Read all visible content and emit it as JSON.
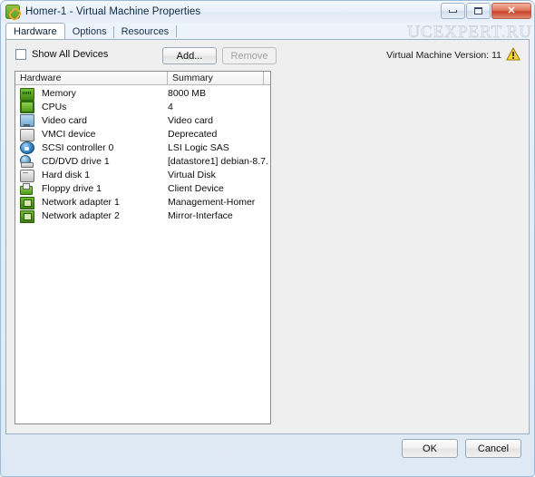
{
  "window": {
    "title": "Homer-1 - Virtual Machine Properties",
    "app_icon": "vm-properties-icon",
    "controls": {
      "minimize": "minimize-button",
      "maximize": "maximize-button",
      "close_glyph": "✕"
    }
  },
  "tabs": [
    {
      "label": "Hardware",
      "active": true
    },
    {
      "label": "Options",
      "active": false
    },
    {
      "label": "Resources",
      "active": false
    }
  ],
  "toolbar": {
    "show_all_devices_label": "Show All Devices",
    "show_all_devices_checked": false,
    "add_label": "Add...",
    "remove_label": "Remove",
    "remove_disabled": true,
    "version_label": "Virtual Machine Version: 11",
    "warning_icon": "warning-triangle-icon"
  },
  "device_list": {
    "columns": [
      "Hardware",
      "Summary"
    ],
    "rows": [
      {
        "icon": "memory-icon",
        "icon_class": "ic-memory",
        "name": "Memory",
        "summary": "8000 MB"
      },
      {
        "icon": "cpu-icon",
        "icon_class": "ic-cpu",
        "name": "CPUs",
        "summary": "4"
      },
      {
        "icon": "video-card-icon",
        "icon_class": "ic-video",
        "name": "Video card",
        "summary": "Video card"
      },
      {
        "icon": "vmci-device-icon",
        "icon_class": "ic-vmci",
        "name": "VMCI device",
        "summary": "Deprecated"
      },
      {
        "icon": "scsi-controller-icon",
        "icon_class": "ic-scsi",
        "name": "SCSI controller 0",
        "summary": "LSI Logic SAS"
      },
      {
        "icon": "cd-dvd-drive-icon",
        "icon_class": "ic-cd",
        "name": "CD/DVD drive 1",
        "summary": "[datastore1] debian-8.7..."
      },
      {
        "icon": "hard-disk-icon",
        "icon_class": "ic-hdd",
        "name": "Hard disk 1",
        "summary": "Virtual Disk"
      },
      {
        "icon": "floppy-drive-icon",
        "icon_class": "ic-floppy",
        "name": "Floppy drive 1",
        "summary": "Client Device"
      },
      {
        "icon": "network-adapter-icon",
        "icon_class": "ic-nic",
        "name": "Network adapter 1",
        "summary": "Management-Homer"
      },
      {
        "icon": "network-adapter-icon",
        "icon_class": "ic-nic",
        "name": "Network adapter 2",
        "summary": "Mirror-Interface"
      }
    ]
  },
  "footer": {
    "ok_label": "OK",
    "cancel_label": "Cancel",
    "watermark": "UCEXPERT.RU"
  },
  "colors": {
    "dialog_background": "#efefef",
    "list_background": "#ffffff",
    "window_border": "#9dbad6",
    "close_button": "#c8412a",
    "accent_green": "#4f9a1d",
    "warning_yellow": "#f2c200"
  }
}
